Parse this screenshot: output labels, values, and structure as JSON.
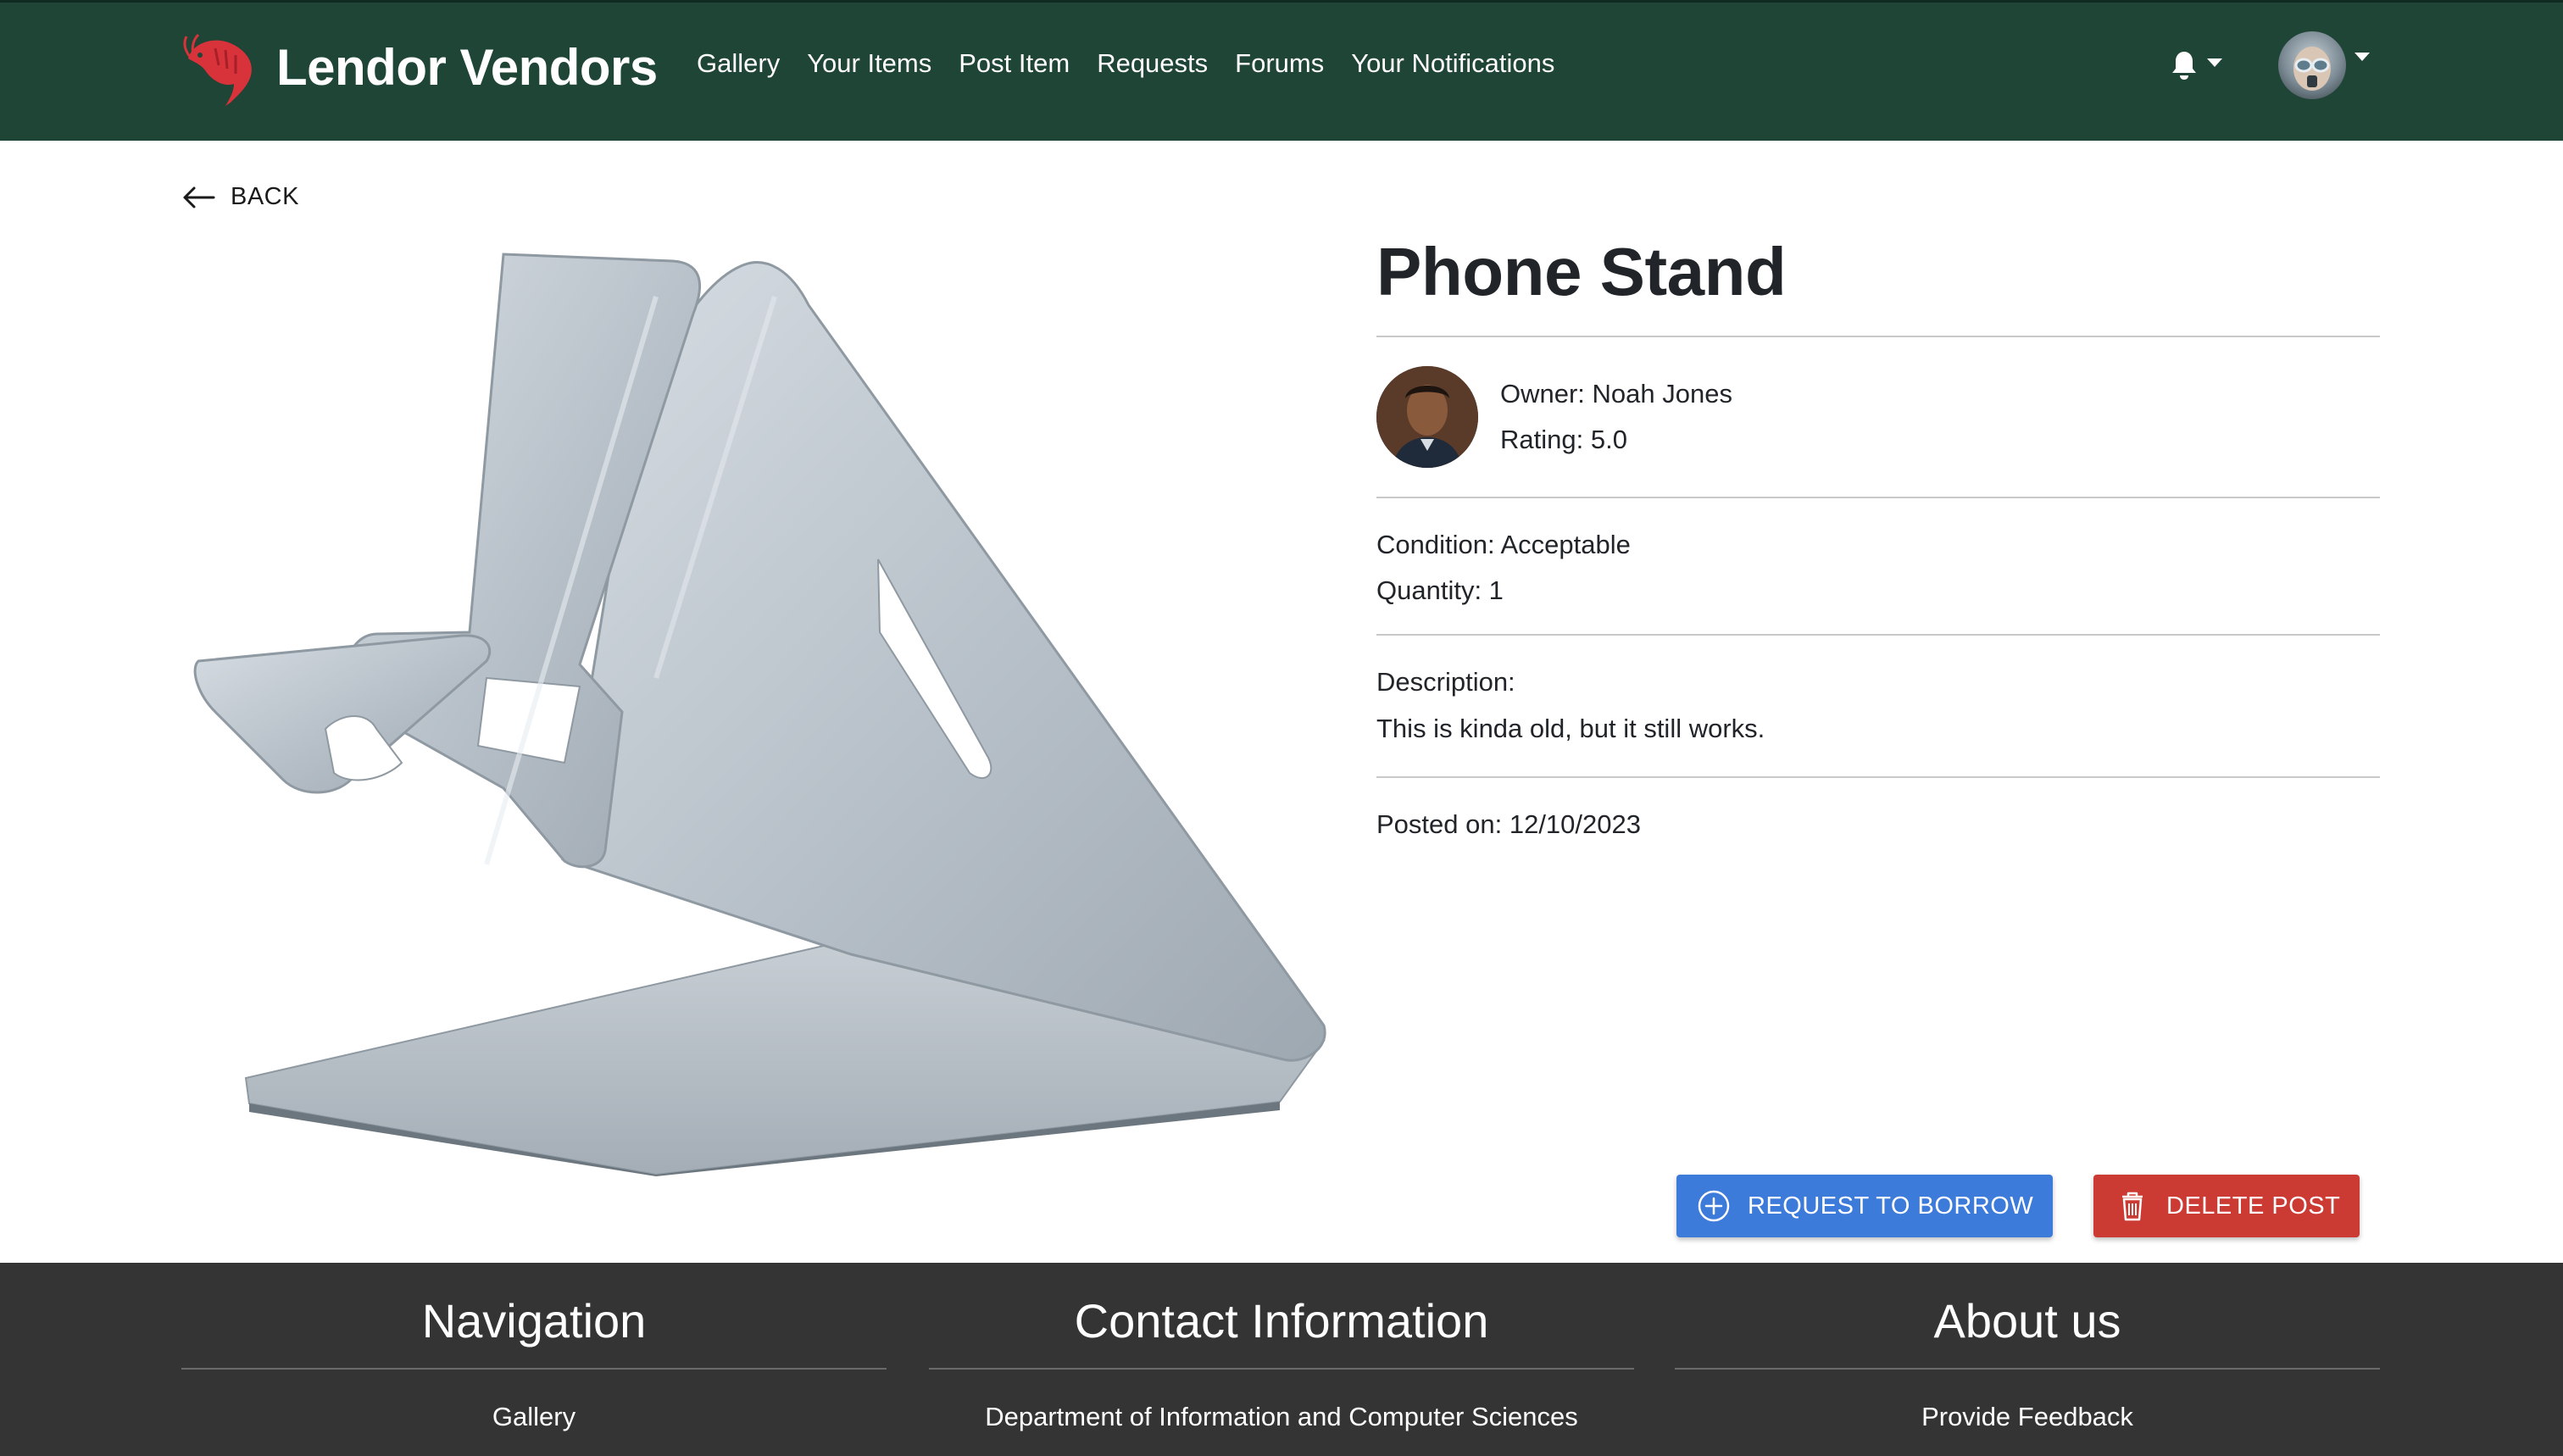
{
  "app": {
    "brand": "Lendor Vendors",
    "nav_links": [
      "Gallery",
      "Your Items",
      "Post Item",
      "Requests",
      "Forums",
      "Your Notifications"
    ],
    "icons": {
      "logo": "shrimp-logo",
      "notifications": "bell-icon",
      "profile": "avatar"
    },
    "colors": {
      "navbar": "#1e4535",
      "footer": "#343434",
      "primary": "#3d7bdb",
      "danger": "#cc3a34"
    }
  },
  "back": {
    "label": "BACK"
  },
  "item": {
    "title": "Phone Stand",
    "owner": "Owner: Noah Jones",
    "rating": "Rating: 5.0",
    "condition": "Condition: Acceptable",
    "quantity": "Quantity: 1",
    "description_label": "Description:",
    "description": "This is kinda old, but it still works.",
    "posted": "Posted on: 12/10/2023"
  },
  "actions": {
    "borrow": "REQUEST TO BORROW",
    "delete": "DELETE POST"
  },
  "footer": {
    "navigation": {
      "title": "Navigation",
      "link": "Gallery"
    },
    "contact": {
      "title": "Contact Information",
      "line": "Department of Information and Computer Sciences"
    },
    "about": {
      "title": "About us",
      "link": "Provide Feedback"
    }
  }
}
